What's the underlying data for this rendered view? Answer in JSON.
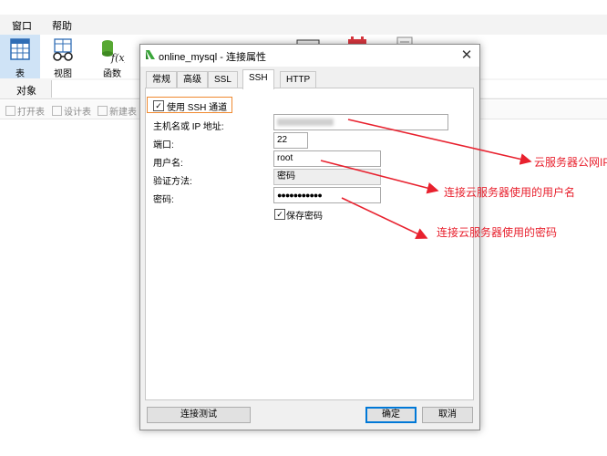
{
  "menubar": {
    "items": [
      "窗口",
      "帮助"
    ]
  },
  "ribbon": {
    "buttons": [
      {
        "label": "表",
        "icon": "table-icon"
      },
      {
        "label": "视图",
        "icon": "view-glasses-icon"
      },
      {
        "label": "函数",
        "icon": "function-icon"
      }
    ]
  },
  "object_bar": {
    "label": "对象"
  },
  "object_tools": [
    "打开表",
    "设计表",
    "新建表"
  ],
  "dialog": {
    "title": "online_mysql - 连接属性",
    "close_glyph": "✕",
    "tabs": [
      "常规",
      "高级",
      "SSL",
      "SSH",
      "HTTP"
    ],
    "active_tab": "SSH",
    "use_ssh_label": "使用 SSH 通道",
    "use_ssh_checked": true,
    "fields": {
      "host_label": "主机名或 IP 地址:",
      "host_value": "",
      "port_label": "端口:",
      "port_value": "22",
      "username_label": "用户名:",
      "username_value": "root",
      "auth_label": "验证方法:",
      "auth_value": "密码",
      "password_label": "密码:",
      "password_value": "●●●●●●●●●●●"
    },
    "save_password_label": "保存密码",
    "save_password_checked": true,
    "buttons": {
      "test": "连接测试",
      "ok": "确定",
      "cancel": "取消"
    }
  },
  "annotations": {
    "host": "云服务器公网IP",
    "username": "连接云服务器使用的用户名",
    "password": "连接云服务器使用的密码",
    "color": "#e8212e"
  },
  "colors": {
    "highlight_box": "#f0892f",
    "ribbon_selected": "#cfe3f6",
    "default_button_border": "#0078d7"
  }
}
